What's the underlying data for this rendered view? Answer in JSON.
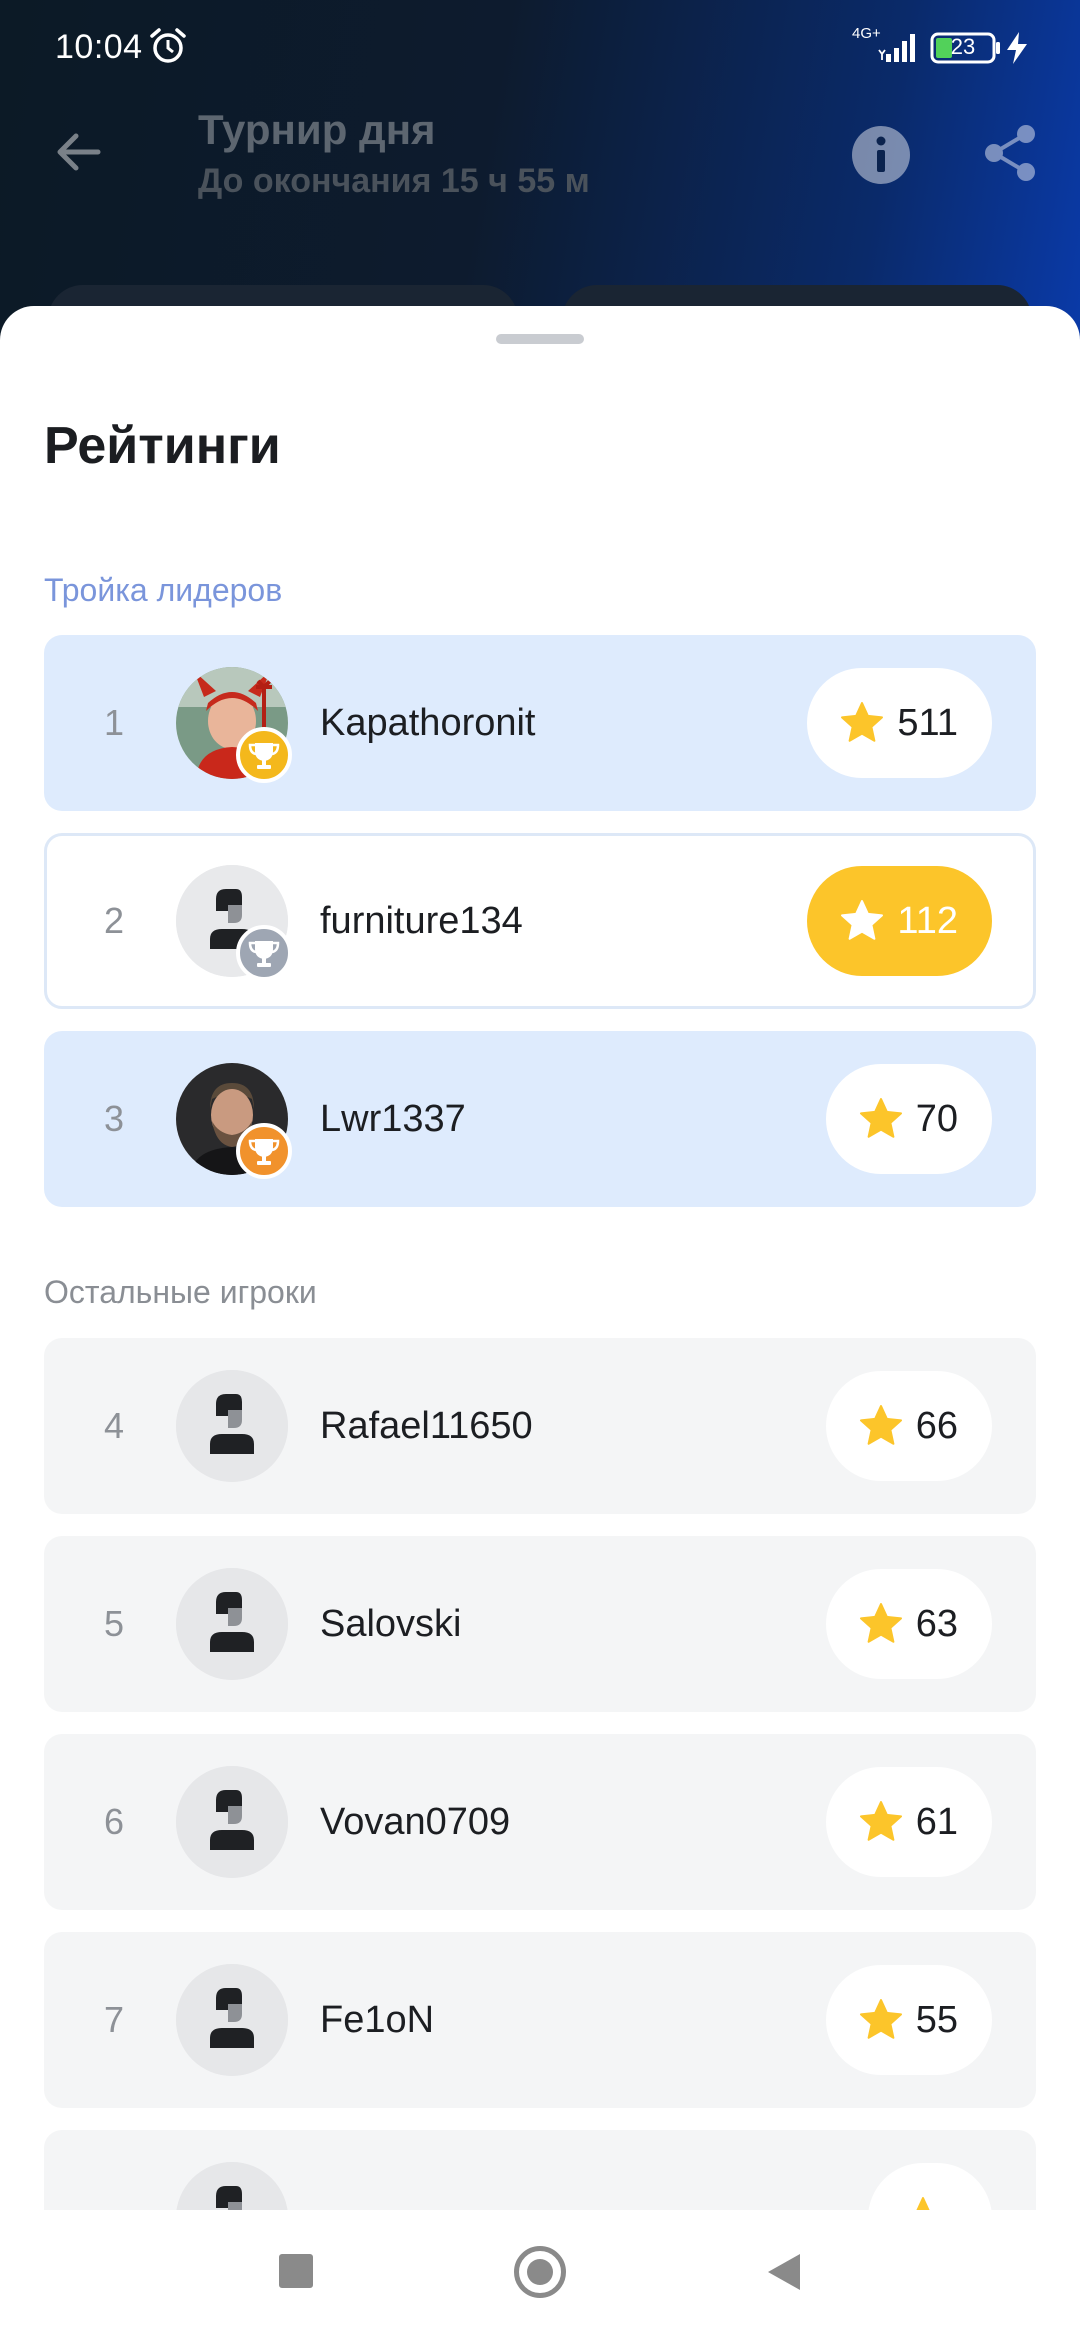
{
  "status_bar": {
    "time": "10:04",
    "network": "4G+",
    "battery": "23"
  },
  "appbar": {
    "title": "Турнир дня",
    "subtitle": "До окончания 15 ч 55 м"
  },
  "sheet": {
    "title": "Рейтинги",
    "section_top": "Тройка лидеров",
    "section_others": "Остальные игроки",
    "leaders": [
      {
        "rank": "1",
        "name": "Kapathoronit",
        "score": "511",
        "cup": "gold",
        "avatar": "photo-devil"
      },
      {
        "rank": "2",
        "name": "furniture134",
        "score": "112",
        "cup": "silver",
        "avatar": "default"
      },
      {
        "rank": "3",
        "name": "Lwr1337",
        "score": "70",
        "cup": "bronze",
        "avatar": "photo-man"
      }
    ],
    "others": [
      {
        "rank": "4",
        "name": "Rafael11650",
        "score": "66"
      },
      {
        "rank": "5",
        "name": "Salovski",
        "score": "63"
      },
      {
        "rank": "6",
        "name": "Vovan0709",
        "score": "61"
      },
      {
        "rank": "7",
        "name": "Fe1oN",
        "score": "55"
      }
    ]
  },
  "colors": {
    "leader_row": "#deebfd",
    "other_row": "#f4f5f6",
    "gold_pill": "#fcc52a",
    "star": "#fcc52a",
    "cup_gold": "#f4b81c",
    "cup_silver": "#9ea6b3",
    "cup_bronze": "#f1922c"
  },
  "icons": [
    "alarm-icon",
    "signal-icon",
    "battery-icon",
    "charge-icon",
    "back-arrow-icon",
    "info-icon",
    "share-icon",
    "star-icon",
    "trophy-icon",
    "default-avatar-icon"
  ]
}
